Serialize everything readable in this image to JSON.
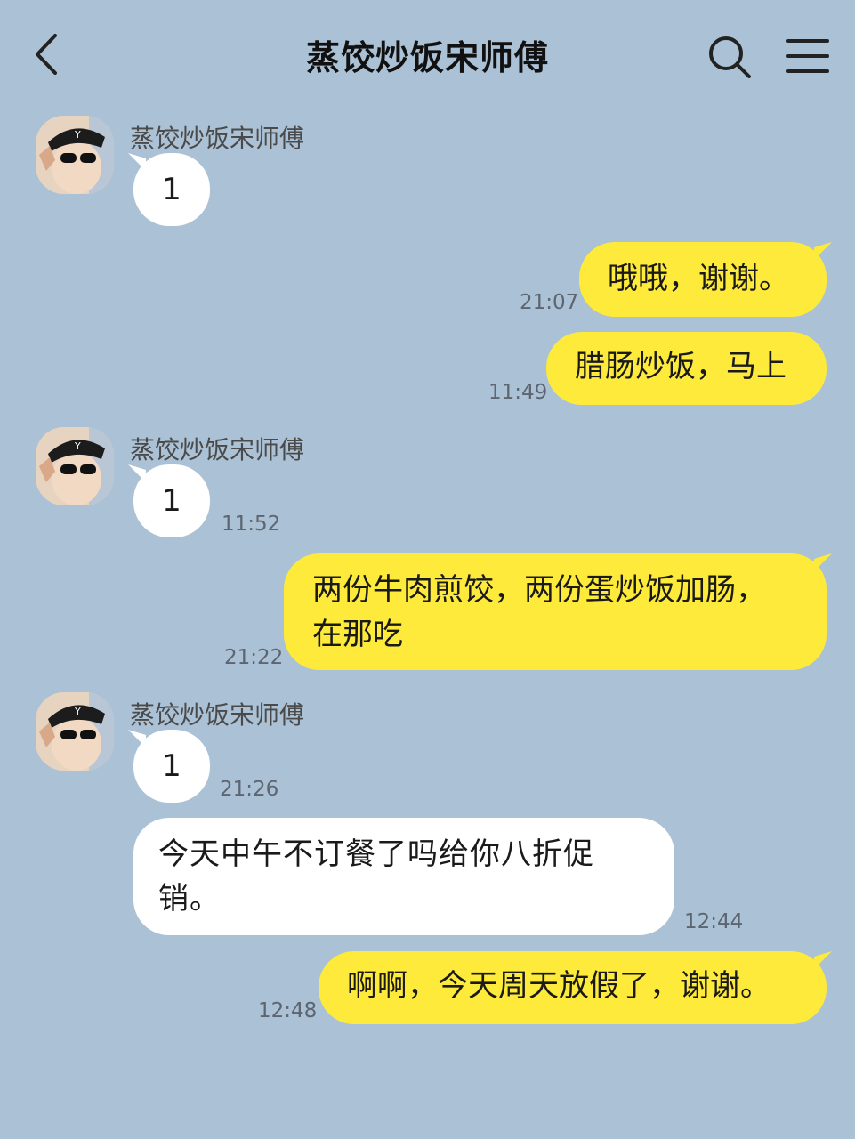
{
  "header": {
    "title": "蒸饺炒饭宋师傅",
    "back_icon": "chevron-left-icon",
    "search_icon": "search-icon",
    "menu_icon": "hamburger-menu-icon"
  },
  "messages": [
    {
      "side": "in",
      "sender": "蒸饺炒饭宋师傅",
      "text": "1",
      "time": ""
    },
    {
      "side": "out",
      "text": "哦哦，谢谢。",
      "time": "21:07"
    },
    {
      "side": "out",
      "text": "腊肠炒饭，马上",
      "time": "11:49"
    },
    {
      "side": "in",
      "sender": "蒸饺炒饭宋师傅",
      "text": "1",
      "time": "11:52"
    },
    {
      "side": "out",
      "text_lines": [
        "两份牛肉煎饺，两份蛋炒饭加肠，",
        "在那吃"
      ],
      "time": "21:22"
    },
    {
      "side": "in",
      "sender": "蒸饺炒饭宋师傅",
      "text": "1",
      "time": "21:26"
    },
    {
      "side": "in",
      "text_lines": [
        "今天中午不订餐了吗给你八折促",
        "销。"
      ],
      "time": "12:44"
    },
    {
      "side": "out",
      "text": "啊啊，今天周天放假了，谢谢。",
      "time": "12:48"
    }
  ],
  "colors": {
    "background": "#abc1d5",
    "outgoing_bubble": "#fdea3b",
    "incoming_bubble": "#ffffff"
  }
}
